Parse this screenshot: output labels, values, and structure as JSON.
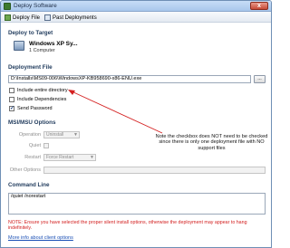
{
  "window": {
    "title": "Deploy Software",
    "close_label": "x"
  },
  "toolbar": {
    "deploy_label": "Deploy File",
    "past_label": "Past Deployments"
  },
  "target": {
    "section_title": "Deploy to Target",
    "name": "Windows XP Sy...",
    "count": "1 Computer"
  },
  "deployment_file": {
    "section_title": "Deployment File",
    "path": "D:\\Installs\\MS09-006\\WindowsXP-KB958690-x86-ENU.exe",
    "browse_label": "...",
    "include_dir_label": "Include entire directory",
    "include_deps_label": "Include Dependencies",
    "send_password_label": "Send Password",
    "include_dir_checked": false,
    "include_deps_checked": false,
    "send_password_checked": true
  },
  "msi_options": {
    "section_title": "MSI/MSU Options",
    "operation_label": "Operation",
    "operation_value": "Uninstall",
    "quiet_label": "Quiet",
    "quiet_checked": false,
    "restart_label": "Restart",
    "restart_value": "Force Restart",
    "other_label": "Other Options"
  },
  "command_line": {
    "section_title": "Command Line",
    "value": "/quiet /norestart",
    "note": "NOTE: Ensure you have selected the proper silent install options, otherwise the deployment may appear to hang indefinitely.",
    "more_link": "More info about client options"
  },
  "annotation": {
    "text": "Note the checkbox does NOT need to be checked since there is only one deployment file with NO support files",
    "arrow_color": "#d42020"
  }
}
